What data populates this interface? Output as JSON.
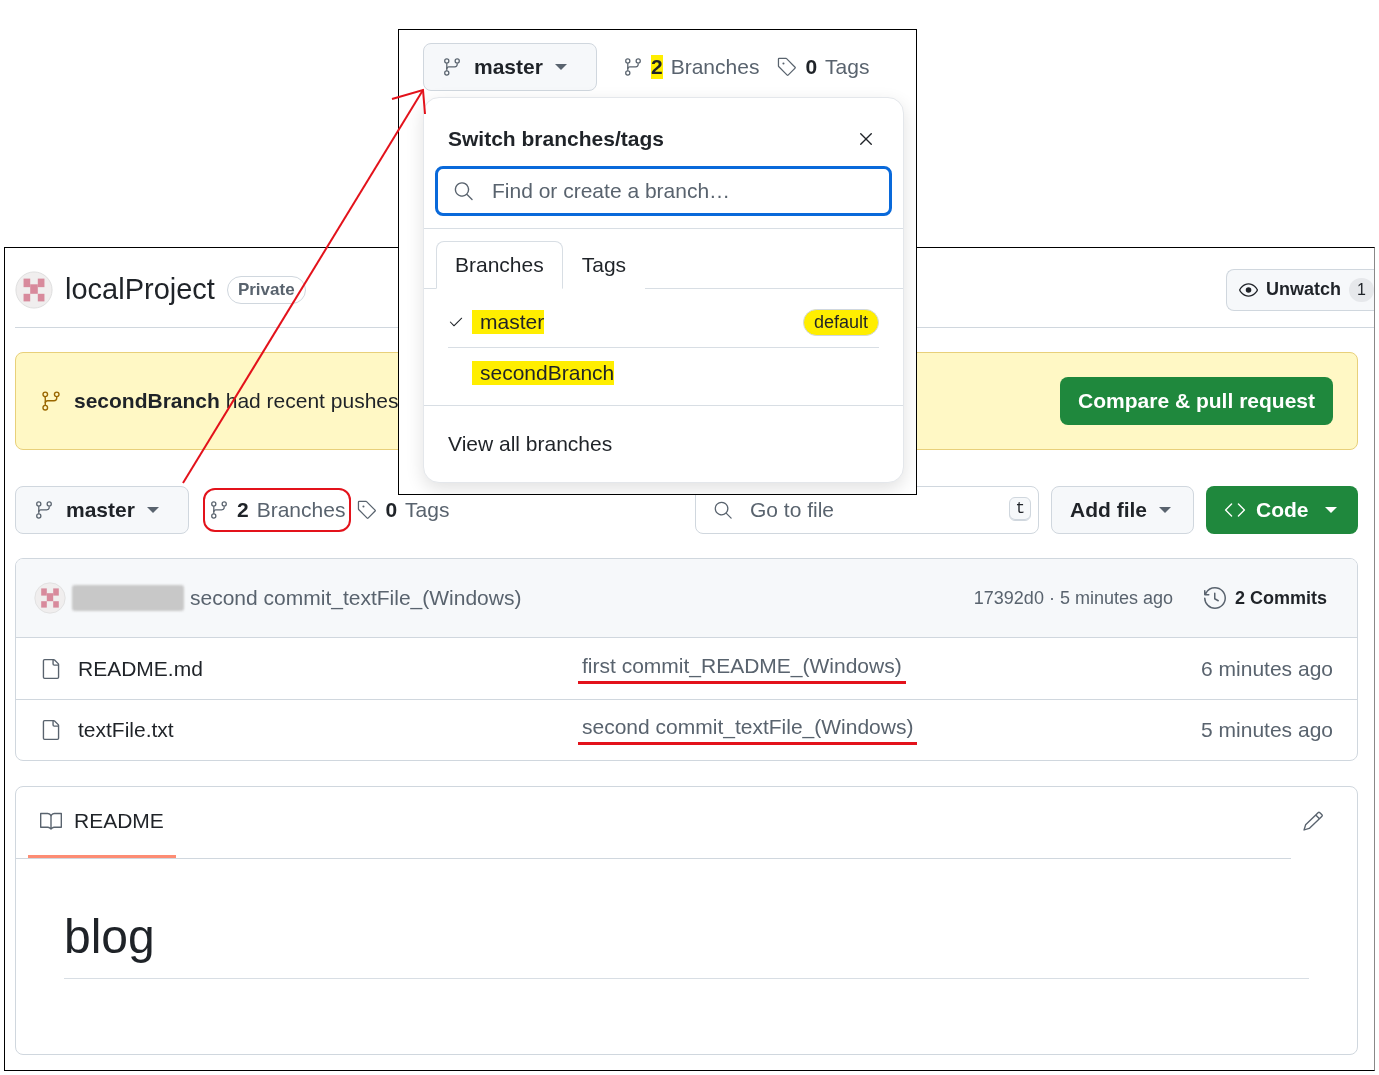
{
  "repo": {
    "name": "localProject",
    "visibility": "Private",
    "watch": {
      "label": "Unwatch",
      "count": "1"
    }
  },
  "banner": {
    "branch": "secondBranch",
    "text": "had recent pushes",
    "button": "Compare & pull request"
  },
  "toolbar": {
    "branch": "master",
    "branches": {
      "count": "2",
      "label": "Branches",
      "circled": true
    },
    "tags": {
      "count": "0",
      "label": "Tags"
    },
    "search": {
      "placeholder": "Go to file",
      "shortcut": "t"
    },
    "add_file": "Add file",
    "code": "Code"
  },
  "latest_commit": {
    "message": "second commit_textFile_(Windows)",
    "meta": "17392d0 · 5 minutes ago",
    "commits": "2 Commits"
  },
  "files": [
    {
      "name": "README.md",
      "message": "first commit_README_(Windows)",
      "underlined": true,
      "time": "6 minutes ago"
    },
    {
      "name": "textFile.txt",
      "message": "second commit_textFile_(Windows)",
      "underlined": true,
      "time": "5 minutes ago"
    }
  ],
  "readme": {
    "tab": "README",
    "heading": "blog"
  },
  "popup": {
    "branch": "master",
    "branches": {
      "count": "2",
      "label": "Branches",
      "count_highlighted": true
    },
    "tags": {
      "count": "0",
      "label": "Tags"
    },
    "title": "Switch branches/tags",
    "search": {
      "placeholder": "Find or create a branch…"
    },
    "tabs": [
      {
        "label": "Branches",
        "selected": true
      },
      {
        "label": "Tags",
        "selected": false
      }
    ],
    "items": [
      {
        "name": "master",
        "selected": true,
        "highlighted": true,
        "badge": "default",
        "badge_highlighted": true
      },
      {
        "name": "secondBranch",
        "selected": false,
        "highlighted": true
      }
    ],
    "footer": "View all branches"
  }
}
